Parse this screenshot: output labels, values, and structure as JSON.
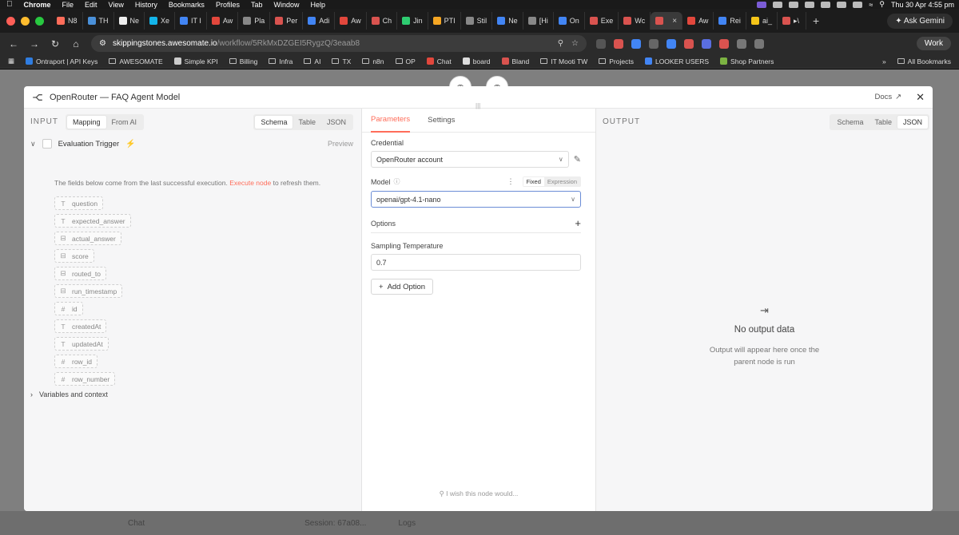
{
  "menubar": {
    "app": "Chrome",
    "items": [
      "File",
      "Edit",
      "View",
      "History",
      "Bookmarks",
      "Profiles",
      "Tab",
      "Window",
      "Help"
    ],
    "datetime": "Thu 30 Apr  4:55 pm"
  },
  "tabs": [
    {
      "label": "N8",
      "color": "#ff6d5a"
    },
    {
      "label": "TH",
      "color": "#4a90d9"
    },
    {
      "label": "Ne",
      "color": "#eeeeee"
    },
    {
      "label": "Xe",
      "color": "#13b5ea"
    },
    {
      "label": "IT I",
      "color": "#4285f4"
    },
    {
      "label": "Aw",
      "color": "#e2473c"
    },
    {
      "label": "Pla",
      "color": "#888888"
    },
    {
      "label": "Per",
      "color": "#d9534f"
    },
    {
      "label": "Adi",
      "color": "#4285f4"
    },
    {
      "label": "Aw",
      "color": "#e2473c"
    },
    {
      "label": "Ch",
      "color": "#d9534f"
    },
    {
      "label": "Jin",
      "color": "#2ecc71"
    },
    {
      "label": "PTI",
      "color": "#f5a623"
    },
    {
      "label": "Stil",
      "color": "#888888"
    },
    {
      "label": "Ne",
      "color": "#4285f4"
    },
    {
      "label": "[Hi",
      "color": "#888888"
    },
    {
      "label": "On",
      "color": "#4285f4"
    },
    {
      "label": "Exe",
      "color": "#d9534f"
    },
    {
      "label": "Wc",
      "color": "#d9534f"
    },
    {
      "label": "",
      "color": "#d9534f",
      "active": true
    },
    {
      "label": "Aw",
      "color": "#e2473c"
    },
    {
      "label": "Rei",
      "color": "#4285f4"
    },
    {
      "label": "ai_",
      "color": "#f5c518"
    },
    {
      "label": "▸\\",
      "color": "#d9534f"
    }
  ],
  "ask_gemini": "Ask Gemini",
  "address": {
    "host": "skippingstones.awesomate.io",
    "path": "/workflow/5RkMxDZGEI5RygzQ/3eaab8"
  },
  "profile": "Work",
  "bookmarks": [
    {
      "label": "Ontraport | API Keys",
      "kind": "dot",
      "color": "#2f7de1"
    },
    {
      "label": "AWESOMATE",
      "kind": "folder"
    },
    {
      "label": "Simple KPI",
      "kind": "dot",
      "color": "#cccccc"
    },
    {
      "label": "Billing",
      "kind": "folder"
    },
    {
      "label": "Infra",
      "kind": "folder"
    },
    {
      "label": "AI",
      "kind": "folder"
    },
    {
      "label": "TX",
      "kind": "folder"
    },
    {
      "label": "n8n",
      "kind": "folder"
    },
    {
      "label": "OP",
      "kind": "folder"
    },
    {
      "label": "Chat",
      "kind": "dot",
      "color": "#e2473c"
    },
    {
      "label": "board",
      "kind": "dot",
      "color": "#dddddd"
    },
    {
      "label": "Bland",
      "kind": "dot",
      "color": "#d9534f"
    },
    {
      "label": "IT Mooti TW",
      "kind": "folder"
    },
    {
      "label": "Projects",
      "kind": "folder"
    },
    {
      "label": "LOOKER USERS",
      "kind": "dot",
      "color": "#4285f4"
    },
    {
      "label": "Shop Partners",
      "kind": "dot",
      "color": "#7cb342"
    }
  ],
  "all_bookmarks": "All Bookmarks",
  "modal": {
    "title": "OpenRouter — FAQ Agent Model",
    "docs": "Docs"
  },
  "input": {
    "label": "INPUT",
    "modes": [
      "Mapping",
      "From AI"
    ],
    "views": [
      "Schema",
      "Table",
      "JSON"
    ],
    "trigger": "Evaluation Trigger",
    "preview": "Preview",
    "hint_before": "The fields below come from the last successful execution.",
    "hint_link": "Execute node",
    "hint_after": "to refresh them.",
    "fields": [
      {
        "type": "T",
        "name": "question"
      },
      {
        "type": "T",
        "name": "expected_answer"
      },
      {
        "type": "⊟",
        "name": "actual_answer"
      },
      {
        "type": "⊟",
        "name": "score"
      },
      {
        "type": "⊟",
        "name": "routed_to"
      },
      {
        "type": "⊟",
        "name": "run_timestamp"
      },
      {
        "type": "#",
        "name": "id"
      },
      {
        "type": "T",
        "name": "createdAt"
      },
      {
        "type": "T",
        "name": "updatedAt"
      },
      {
        "type": "#",
        "name": "row_id"
      },
      {
        "type": "#",
        "name": "row_number"
      }
    ],
    "vars": "Variables and context"
  },
  "params": {
    "tabs": [
      "Parameters",
      "Settings"
    ],
    "credential_label": "Credential",
    "credential_value": "OpenRouter account",
    "model_label": "Model",
    "fixed": "Fixed",
    "expression": "Expression",
    "model_value": "openai/gpt-4.1-nano",
    "options_label": "Options",
    "temp_label": "Sampling Temperature",
    "temp_value": "0.7",
    "add_option": "Add Option",
    "wish": "I wish this node would..."
  },
  "output": {
    "label": "OUTPUT",
    "views": [
      "Schema",
      "Table",
      "JSON"
    ],
    "empty_title": "No output data",
    "empty_line1": "Output will appear here once the",
    "empty_line2": "parent node is run"
  },
  "background": {
    "chat": "Chat",
    "session": "Session: 67a08...",
    "logs": "Logs"
  }
}
